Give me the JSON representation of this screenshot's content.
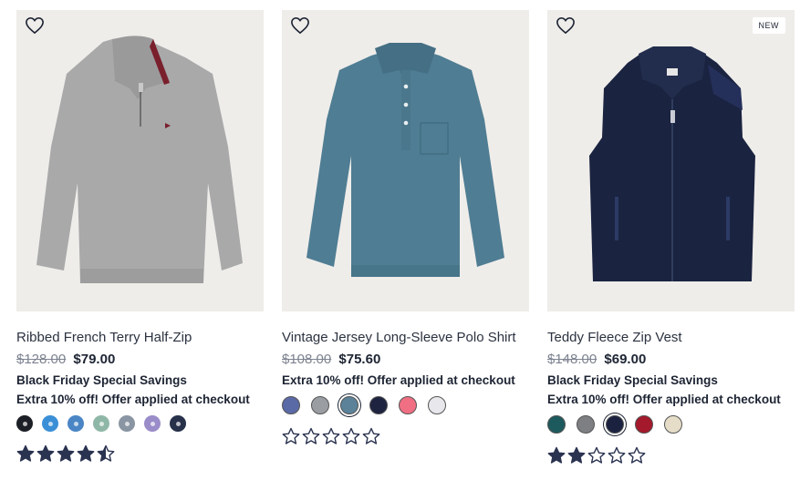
{
  "products": [
    {
      "title": "Ribbed French Terry Half-Zip",
      "original_price": "$128.00",
      "sale_price": "$79.00",
      "promo_line1": "Black Friday Special Savings",
      "promo_line2": "Extra 10% off! Offer applied at checkout",
      "badge": "",
      "rating": 4.5,
      "swatches": [
        "#1c1f26",
        "#3b8fd6",
        "#4a86c5",
        "#8fb7a8",
        "#8a95a3",
        "#9a8cc9",
        "#27314a"
      ]
    },
    {
      "title": "Vintage Jersey Long-Sleeve Polo Shirt",
      "original_price": "$108.00",
      "sale_price": "$75.60",
      "promo_line1": "Extra 10% off! Offer applied at checkout",
      "badge": "",
      "rating": 0,
      "swatches": [
        "#5a6aa6",
        "#9a9ea3",
        "#5b8299",
        "#1e2340",
        "#f06f83",
        "#e7e7ec"
      ],
      "selected_swatch": 2
    },
    {
      "title": "Teddy Fleece Zip Vest",
      "original_price": "$148.00",
      "sale_price": "$69.00",
      "promo_line1": "Black Friday Special Savings",
      "promo_line2": "Extra 10% off! Offer applied at checkout",
      "badge": "NEW",
      "rating": 2,
      "swatches": [
        "#1d5a5e",
        "#7d7f82",
        "#1b2240",
        "#a4192c",
        "#e6ddc9"
      ],
      "selected_swatch": 2
    }
  ],
  "colors": {
    "text": "#1d2433",
    "muted": "#7d8390",
    "image_bg": "#efedea",
    "star": "#2a3350"
  },
  "icons": {
    "favorite": "heart-outline-icon",
    "rating": "star-icon"
  }
}
